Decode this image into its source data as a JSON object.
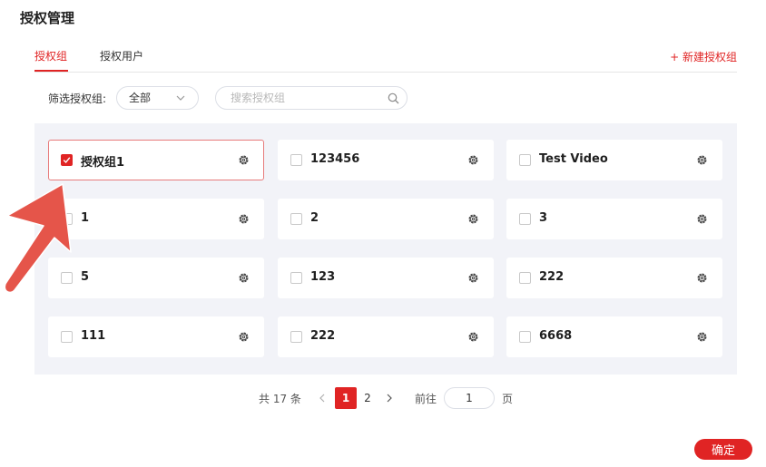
{
  "page": {
    "title": "授权管理"
  },
  "tabs": [
    {
      "label": "授权组",
      "active": true
    },
    {
      "label": "授权用户",
      "active": false
    }
  ],
  "new_group_label": "+ 新建授权组",
  "filter": {
    "label": "筛选授权组:",
    "select_value": "全部",
    "search_placeholder": "搜索授权组"
  },
  "groups": [
    {
      "name": "授权组1",
      "checked": true
    },
    {
      "name": "123456",
      "checked": false
    },
    {
      "name": "Test Video",
      "checked": false
    },
    {
      "name": "1",
      "checked": false
    },
    {
      "name": "2",
      "checked": false
    },
    {
      "name": "3",
      "checked": false
    },
    {
      "name": "5",
      "checked": false
    },
    {
      "name": "123",
      "checked": false
    },
    {
      "name": "222",
      "checked": false
    },
    {
      "name": "111",
      "checked": false
    },
    {
      "name": "222",
      "checked": false
    },
    {
      "name": "6668",
      "checked": false
    }
  ],
  "pagination": {
    "total_text": "共 17 条",
    "pages": [
      "1",
      "2"
    ],
    "current": "1",
    "goto_label": "前往",
    "goto_value": "1",
    "page_suffix": "页"
  },
  "confirm_label": "确定",
  "colors": {
    "accent": "#e02424",
    "grid_bg": "#f2f3f8",
    "selected_border": "#e77b7b",
    "arrow": "#e5554a"
  },
  "icons": {
    "gear": "gear-icon",
    "search": "search-icon",
    "chevron": "chevron-down-icon",
    "check": "check-icon"
  }
}
